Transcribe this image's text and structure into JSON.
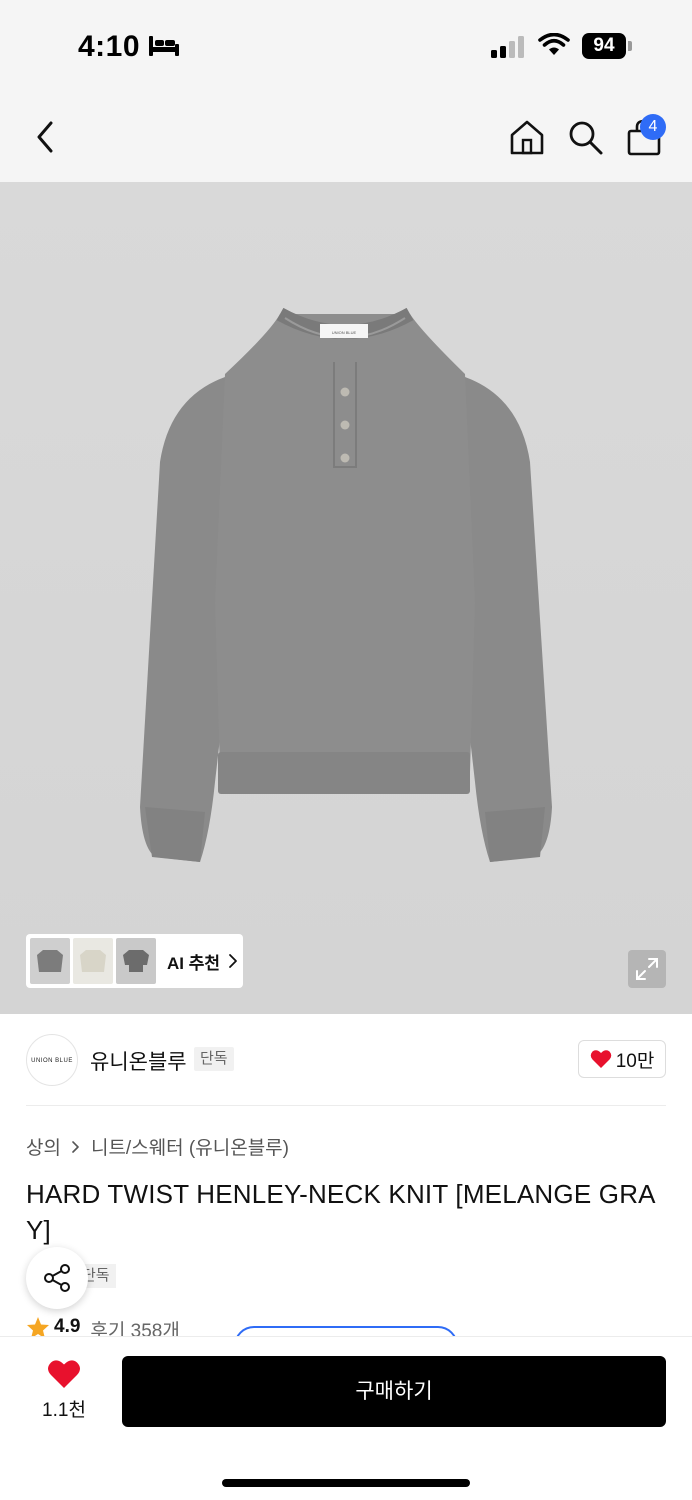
{
  "status_bar": {
    "time": "4:10",
    "battery": "94"
  },
  "nav": {
    "cart_count": "4"
  },
  "gallery": {
    "ai_label": "AI 추천",
    "sweater_tag": "UNION BLUE"
  },
  "brand": {
    "logo_text": "UNION BLUE",
    "name": "유니온블루",
    "tag": "단독",
    "likes": "10만"
  },
  "breadcrumb": {
    "category": "상의",
    "subcategory": "니트/스웨터 (유니온블루)"
  },
  "product": {
    "title": "HARD TWIST HENLEY-NECK KNIT [MELANGE GRAY]",
    "exclusive_tag": "단독",
    "rating": "4.9",
    "reviews": "후기 358개"
  },
  "bottom": {
    "likes": "1.1천",
    "buy_label": "구매하기"
  },
  "colors": {
    "accent_blue": "#2f6cf6",
    "heart_red": "#e8112d",
    "star_orange": "#f5a623",
    "buy_black": "#000000"
  }
}
